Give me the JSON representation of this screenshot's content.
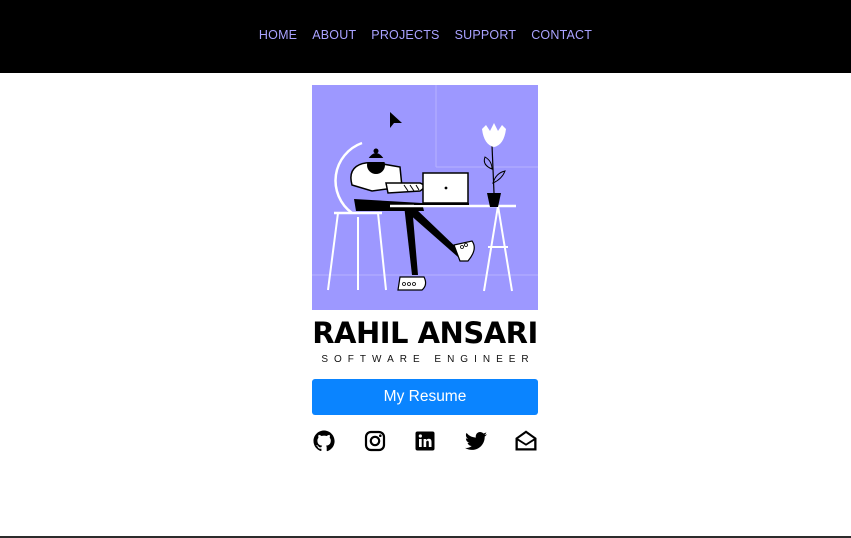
{
  "nav": {
    "items": [
      {
        "label": "HOME"
      },
      {
        "label": "ABOUT"
      },
      {
        "label": "PROJECTS"
      },
      {
        "label": "SUPPORT"
      },
      {
        "label": "CONTACT"
      }
    ],
    "link_color": "#a9a2ff",
    "background": "#000000"
  },
  "hero": {
    "illustration": {
      "icon": "person-working-on-laptop-illustration",
      "background": "#9d98ff"
    },
    "name": "RAHIL ANSARI",
    "role": "SOFTWARE ENGINEER",
    "resume_button": "My Resume",
    "button_color": "#0a84ff"
  },
  "socials": [
    {
      "icon": "github-icon"
    },
    {
      "icon": "instagram-icon"
    },
    {
      "icon": "linkedin-icon"
    },
    {
      "icon": "twitter-icon"
    },
    {
      "icon": "email-icon"
    }
  ]
}
